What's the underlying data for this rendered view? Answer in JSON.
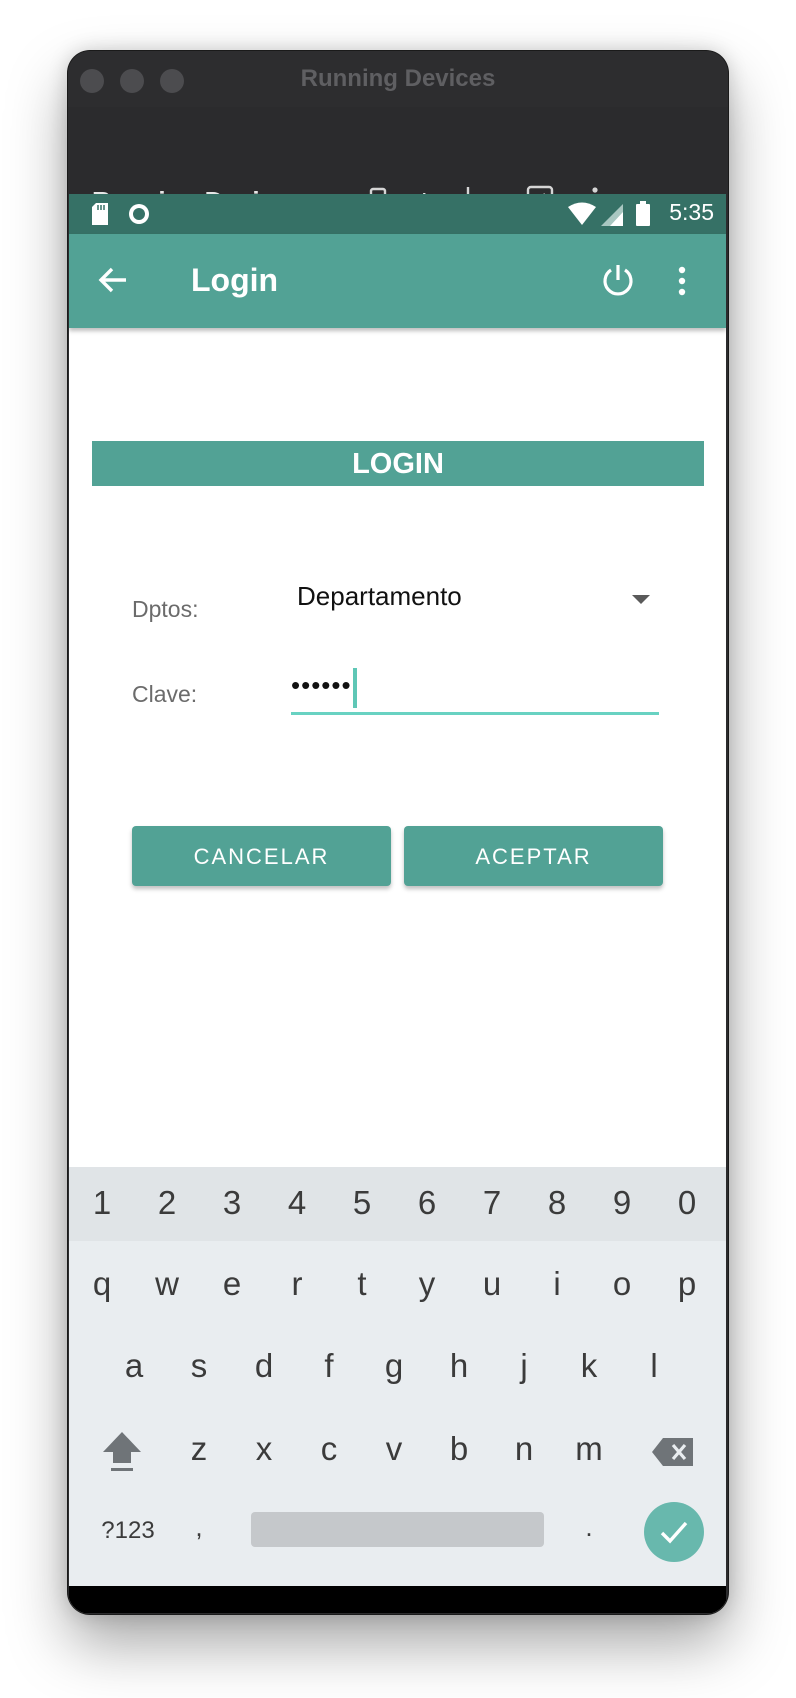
{
  "window": {
    "title": "Running Devices"
  },
  "toolbar": {
    "panel_title": "Running Devices",
    "tab_label": "Pi..."
  },
  "status_bar": {
    "time": "5:35"
  },
  "app_bar": {
    "title": "Login"
  },
  "form": {
    "banner": "LOGIN",
    "dept_label": "Dptos:",
    "dept_value": "Departamento",
    "password_label": "Clave:",
    "password_value": "••••••",
    "cancel_label": "CANCELAR",
    "accept_label": "ACEPTAR"
  },
  "keyboard": {
    "numbers": [
      "1",
      "2",
      "3",
      "4",
      "5",
      "6",
      "7",
      "8",
      "9",
      "0"
    ],
    "row1": [
      "q",
      "w",
      "e",
      "r",
      "t",
      "y",
      "u",
      "i",
      "o",
      "p"
    ],
    "row2": [
      "a",
      "s",
      "d",
      "f",
      "g",
      "h",
      "j",
      "k",
      "l"
    ],
    "row3": [
      "z",
      "x",
      "c",
      "v",
      "b",
      "n",
      "m"
    ],
    "symbols_label": "?123",
    "comma": ",",
    "period": "."
  },
  "colors": {
    "accent": "#52a295",
    "status_bar": "#367166",
    "field_underline": "#68d2c2"
  }
}
